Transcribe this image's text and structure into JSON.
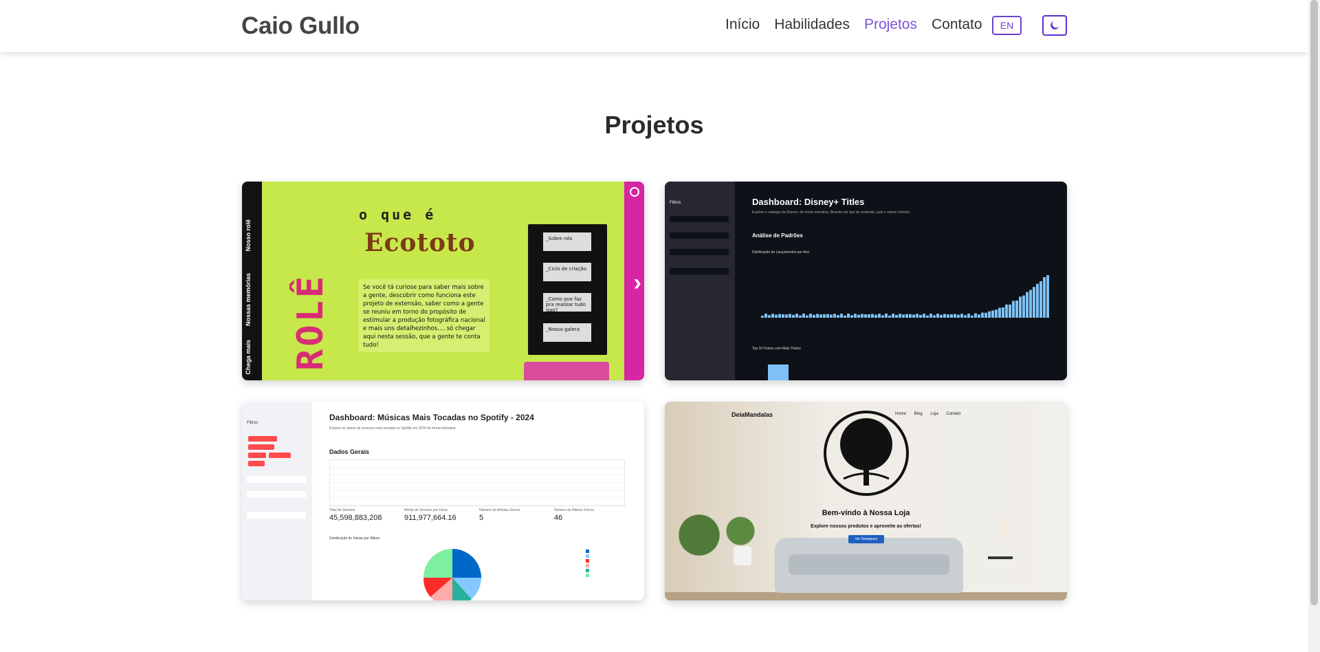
{
  "navbar": {
    "brand": "Caio Gullo",
    "links": [
      "Início",
      "Habilidades",
      "Projetos",
      "Contato"
    ],
    "active_link": "Projetos",
    "lang_button": "EN",
    "theme_icon": "moon-icon"
  },
  "section": {
    "title": "Projetos"
  },
  "colors": {
    "accent": "#7a52e0",
    "button_border": "#6b3fd4"
  },
  "projects": [
    {
      "sidebar_labels": [
        "Nosso rolê",
        "Nossas memórias",
        "Chega mais"
      ],
      "heading_small": "o que é",
      "heading_big": "Ecototo",
      "vertical_text": "ROLÊ",
      "paragraph": "Se você tá curiose para saber mais sobre a gente, descobrir como funciona este projeto de extensão, saber como a gente se reuniu em torno do propósito de estimular a produção fotográfica nacional e mais uns detalhezinhos.... só chegar aqui nesta sessão, que a gente te conta tudo!",
      "film_frames": [
        "_Sobre nós",
        "_Ciclo de criação",
        "_Como que faz pra realizar tudo isso?",
        "_Nossa galera"
      ]
    },
    {
      "title": "Dashboard: Disney+ Titles",
      "subtitle": "Explore o catálogo da Disney+ de forma interativa, filtrando por tipo de conteúdo, país e outros critérios.",
      "sidebar_title": "Filtros",
      "section": "Análise de Padrões",
      "chart_label": "Distribuição de Lançamentos por Ano",
      "chart2_label": "Top 10 Países com Mais Títulos"
    },
    {
      "title": "Dashboard: Músicas Mais Tocadas no Spotify - 2024",
      "subtitle": "Explore os dados de músicas mais tocadas no Spotify em 2024 de forma interativa.",
      "sidebar_title": "Filtros",
      "section": "Dados Gerais",
      "metrics": [
        {
          "label": "Total de Streams",
          "value": "45,598,883,208"
        },
        {
          "label": "Média de Streams por Faixa",
          "value": "911,977,664.16"
        },
        {
          "label": "Número de Artistas Únicos",
          "value": "5"
        },
        {
          "label": "Número de Álbuns Únicos",
          "value": "46"
        }
      ],
      "pie_label": "Distribuição de Faixas por Álbum"
    },
    {
      "logo": "DeiaMandalas",
      "menu": [
        "Home",
        "Blog",
        "Loja",
        "Contato"
      ],
      "welcome": "Bem-vindo à Nossa Loja",
      "explore": "Explore nossos produtos e aproveite as ofertas!",
      "cta": "Ver Destaques"
    }
  ]
}
